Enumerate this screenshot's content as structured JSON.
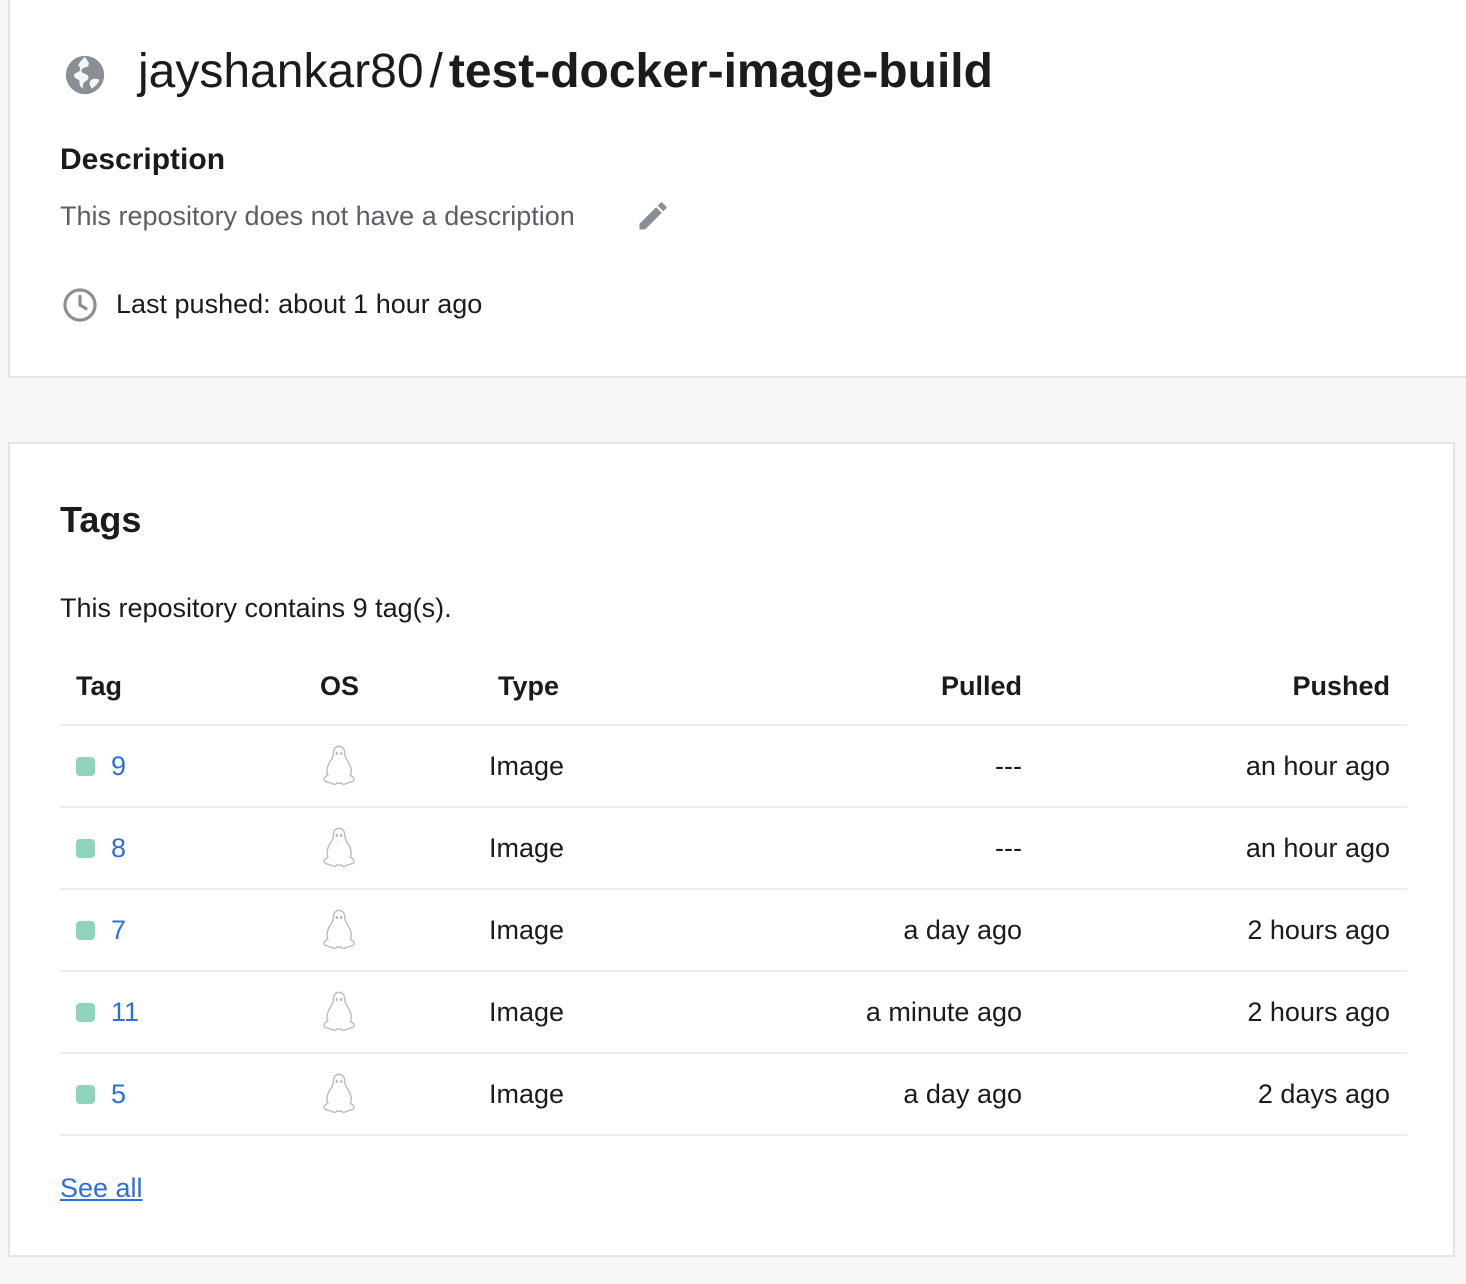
{
  "repo": {
    "owner": "jayshankar80",
    "separator": "/",
    "name": "test-docker-image-build",
    "visibility_icon": "globe-icon"
  },
  "description": {
    "heading": "Description",
    "text": "This repository does not have a description",
    "edit_icon": "pencil-icon"
  },
  "last_pushed": {
    "icon": "clock-icon",
    "text": "Last pushed: about 1 hour ago"
  },
  "tags": {
    "heading": "Tags",
    "count_text": "This repository contains 9 tag(s).",
    "columns": {
      "tag": "Tag",
      "os": "OS",
      "type": "Type",
      "pulled": "Pulled",
      "pushed": "Pushed"
    },
    "rows": [
      {
        "tag": "9",
        "os": "linux-icon",
        "type": "Image",
        "pulled": "---",
        "pushed": "an hour ago"
      },
      {
        "tag": "8",
        "os": "linux-icon",
        "type": "Image",
        "pulled": "---",
        "pushed": "an hour ago"
      },
      {
        "tag": "7",
        "os": "linux-icon",
        "type": "Image",
        "pulled": "a day ago",
        "pushed": "2 hours ago"
      },
      {
        "tag": "11",
        "os": "linux-icon",
        "type": "Image",
        "pulled": "a minute ago",
        "pushed": "2 hours ago"
      },
      {
        "tag": "5",
        "os": "linux-icon",
        "type": "Image",
        "pulled": "a day ago",
        "pushed": "2 days ago"
      }
    ],
    "see_all": "See all"
  },
  "colors": {
    "link": "#2c6fdb",
    "tag_status": "#8fd3bd",
    "muted_text": "#5a5f66",
    "page_background": "#f7f7f7"
  }
}
